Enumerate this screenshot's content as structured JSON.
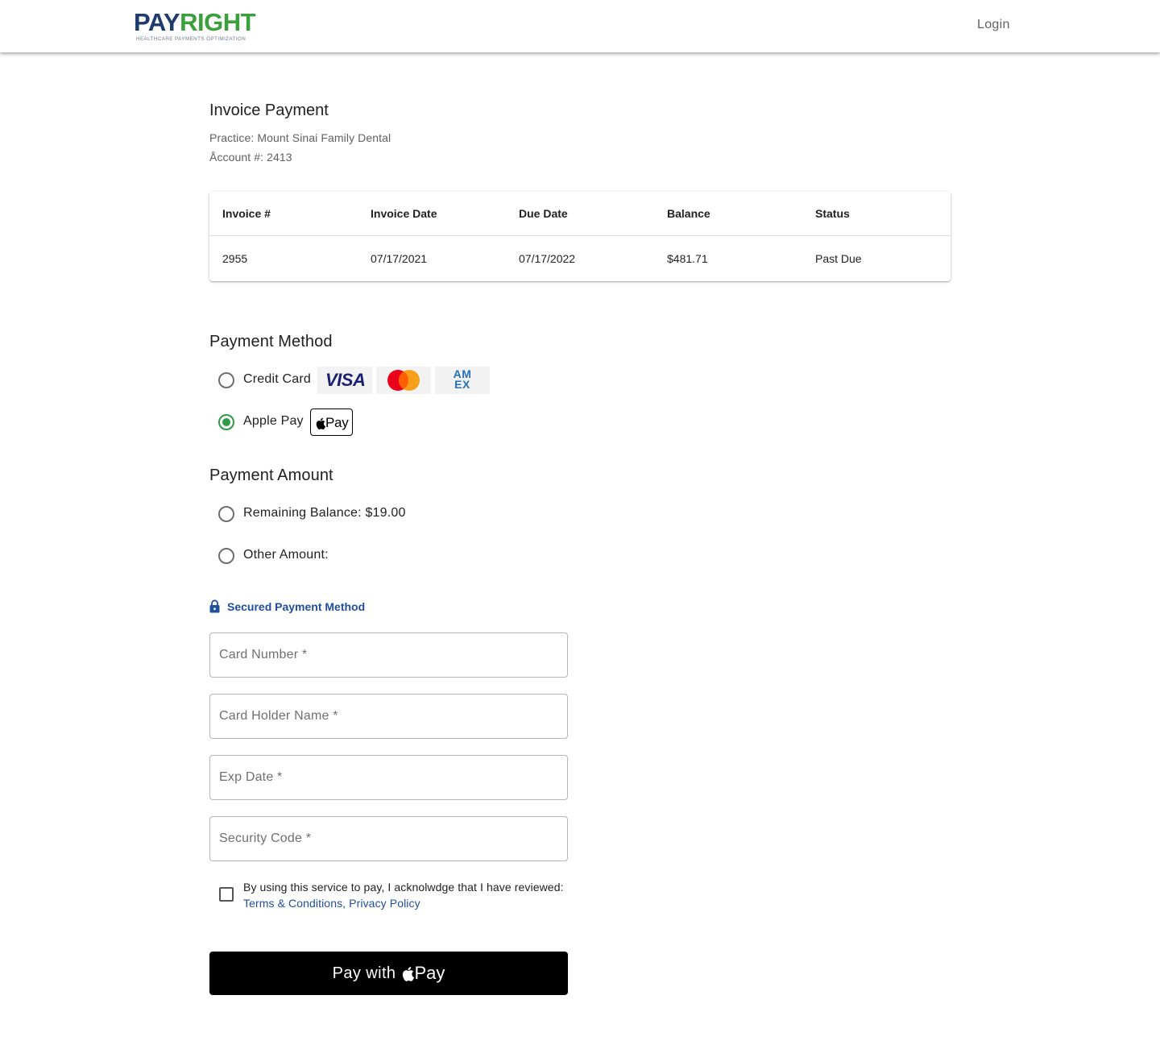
{
  "header": {
    "logo_part1": "PAY",
    "logo_part2": "RIGHT",
    "logo_tagline": "HEALTHCARE PAYMENTS OPTIMIZATION",
    "login_label": "Login"
  },
  "invoice": {
    "title": "Invoice Payment",
    "practice": "Practice: Mount Sinai Family Dental",
    "account": "Åccount #: 2413",
    "table": {
      "columns": [
        "Invoice #",
        "Invoice Date",
        "Due Date",
        "Balance",
        "Status"
      ],
      "rows": [
        [
          "2955",
          "07/17/2021",
          "07/17/2022",
          "$481.71",
          "Past Due"
        ]
      ]
    }
  },
  "payment_method": {
    "title": "Payment Method",
    "options": [
      {
        "label": "Credit Card",
        "selected": false
      },
      {
        "label": "Apple Pay",
        "selected": true
      }
    ],
    "brands": {
      "visa": "VISA",
      "mastercard_icon": "mastercard-icon",
      "amex": "AM EX",
      "applepay": "Pay"
    }
  },
  "payment_amount": {
    "title": "Payment Amount",
    "options": [
      {
        "label": "Remaining Balance: $19.00",
        "selected": false
      },
      {
        "label": "Other Amount:",
        "selected": false
      }
    ]
  },
  "secure_form": {
    "label": "Secured Payment Method",
    "icon": "lock-icon",
    "fields": {
      "card_number": {
        "placeholder": "Card Number *",
        "value": ""
      },
      "card_holder": {
        "placeholder": "Card Holder Name *",
        "value": ""
      },
      "exp_date": {
        "placeholder": "Exp Date *",
        "value": ""
      },
      "security_code": {
        "placeholder": "Security Code *",
        "value": ""
      }
    }
  },
  "agreement": {
    "text": "By using this service to pay, I acknolwdge that I have reviewed:",
    "terms_link": "Terms & Conditions,",
    "privacy_link": "Privacy Policy",
    "checked": false
  },
  "pay_button": {
    "label": "Pay with",
    "suffix": "Pay"
  },
  "colors": {
    "brand_navy": "#1e3b6e",
    "brand_green": "#3aa03a",
    "radio_selected": "#2e9b46",
    "link": "#1f4e9c",
    "button": "#000000"
  }
}
